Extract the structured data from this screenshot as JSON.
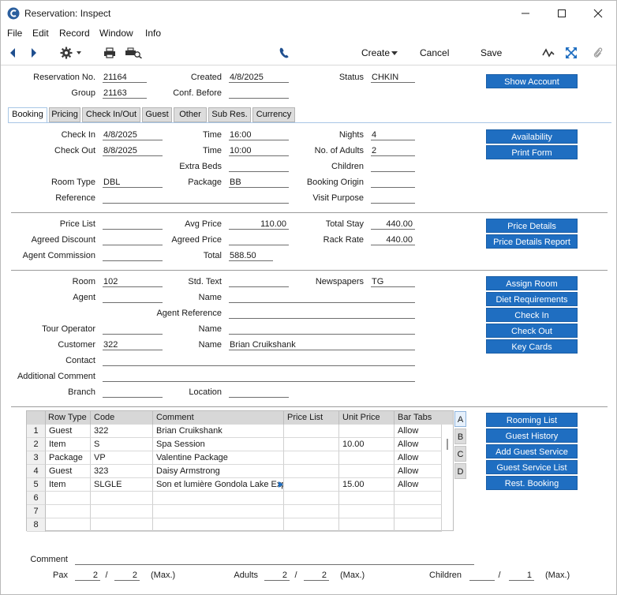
{
  "window": {
    "title": "Reservation: Inspect"
  },
  "menu": [
    "File",
    "Edit",
    "Record",
    "Window",
    "Info"
  ],
  "toolbar": {
    "create": "Create",
    "cancel": "Cancel",
    "save": "Save"
  },
  "header": {
    "reservation_no_label": "Reservation No.",
    "reservation_no": "21164",
    "created_label": "Created",
    "created": "4/8/2025",
    "status_label": "Status",
    "status": "CHKIN",
    "group_label": "Group",
    "group": "21163",
    "conf_before_label": "Conf. Before",
    "conf_before": "",
    "show_account": "Show Account"
  },
  "tabs": [
    "Booking",
    "Pricing",
    "Check In/Out",
    "Guest",
    "Other",
    "Sub Res.",
    "Currency"
  ],
  "booking": {
    "check_in_label": "Check In",
    "check_in": "4/8/2025",
    "time1_label": "Time",
    "time_in": "16:00",
    "nights_label": "Nights",
    "nights": "4",
    "check_out_label": "Check Out",
    "check_out": "8/8/2025",
    "time2_label": "Time",
    "time_out": "10:00",
    "adults_label": "No. of Adults",
    "adults": "2",
    "extra_beds_label": "Extra Beds",
    "extra_beds": "",
    "children_label": "Children",
    "children": "",
    "room_type_label": "Room Type",
    "room_type": "DBL",
    "package_label": "Package",
    "package": "BB",
    "booking_origin_label": "Booking Origin",
    "booking_origin": "",
    "reference_label": "Reference",
    "reference": "",
    "visit_purpose_label": "Visit Purpose",
    "visit_purpose": "",
    "availability": "Availability",
    "print_form": "Print Form"
  },
  "pricing": {
    "price_list_label": "Price List",
    "price_list": "",
    "avg_price_label": "Avg Price",
    "avg_price": "110.00",
    "total_stay_label": "Total Stay",
    "total_stay": "440.00",
    "agreed_discount_label": "Agreed Discount",
    "agreed_discount": "",
    "agreed_price_label": "Agreed Price",
    "agreed_price": "",
    "rack_rate_label": "Rack Rate",
    "rack_rate": "440.00",
    "agent_commission_label": "Agent Commission",
    "agent_commission": "",
    "total_label": "Total",
    "total": "588.50",
    "price_details": "Price Details",
    "price_details_report": "Price Details Report"
  },
  "room": {
    "room_label": "Room",
    "room": "102",
    "std_text_label": "Std. Text",
    "std_text": "",
    "newspapers_label": "Newspapers",
    "newspapers": "TG",
    "agent_label": "Agent",
    "agent": "",
    "name1_label": "Name",
    "agent_name": "",
    "agent_reference_label": "Agent Reference",
    "agent_reference": "",
    "tour_operator_label": "Tour Operator",
    "tour_operator": "",
    "name2_label": "Name",
    "tour_operator_name": "",
    "customer_label": "Customer",
    "customer": "322",
    "name3_label": "Name",
    "customer_name": "Brian Cruikshank",
    "contact_label": "Contact",
    "contact": "",
    "additional_comment_label": "Additional Comment",
    "additional_comment": "",
    "branch_label": "Branch",
    "branch": "",
    "location_label": "Location",
    "location": "",
    "assign_room": "Assign Room",
    "diet_requirements": "Diet Requirements",
    "check_in_btn": "Check In",
    "check_out_btn": "Check Out",
    "key_cards": "Key Cards"
  },
  "grid": {
    "columns": [
      "Row Type",
      "Code",
      "Comment",
      "Price List",
      "Unit Price",
      "Bar Tabs"
    ],
    "rows": [
      {
        "n": "1",
        "type": "Guest",
        "code": "322",
        "comment": "Brian Cruikshank",
        "price_list": "",
        "unit_price": "",
        "bar_tabs": "Allow"
      },
      {
        "n": "2",
        "type": "Item",
        "code": "S",
        "comment": "Spa Session",
        "price_list": "",
        "unit_price": "10.00",
        "bar_tabs": "Allow"
      },
      {
        "n": "3",
        "type": "Package",
        "code": "VP",
        "comment": "Valentine Package",
        "price_list": "",
        "unit_price": "",
        "bar_tabs": "Allow"
      },
      {
        "n": "4",
        "type": "Guest",
        "code": "323",
        "comment": "Daisy Armstrong",
        "price_list": "",
        "unit_price": "",
        "bar_tabs": "Allow"
      },
      {
        "n": "5",
        "type": "Item",
        "code": "SLGLE",
        "comment": "Son et lumière Gondola Lake Exp",
        "price_list": "",
        "unit_price": "15.00",
        "bar_tabs": "Allow"
      },
      {
        "n": "6",
        "type": "",
        "code": "",
        "comment": "",
        "price_list": "",
        "unit_price": "",
        "bar_tabs": ""
      },
      {
        "n": "7",
        "type": "",
        "code": "",
        "comment": "",
        "price_list": "",
        "unit_price": "",
        "bar_tabs": ""
      },
      {
        "n": "8",
        "type": "",
        "code": "",
        "comment": "",
        "price_list": "",
        "unit_price": "",
        "bar_tabs": ""
      }
    ],
    "side_tabs": [
      "A",
      "B",
      "C",
      "D"
    ],
    "buttons": [
      "Rooming List",
      "Guest History",
      "Add Guest Service",
      "Guest Service List",
      "Rest. Booking"
    ]
  },
  "footer": {
    "comment_label": "Comment",
    "comment": "",
    "pax_label": "Pax",
    "pax": "2",
    "pax_max": "2",
    "max1": "(Max.)",
    "adults_label": "Adults",
    "adults": "2",
    "adults_max": "2",
    "max2": "(Max.)",
    "children_label": "Children",
    "children": "",
    "children_max": "1",
    "max3": "(Max.)",
    "slash": "/"
  },
  "colors": {
    "button_blue": "#1f6ec1",
    "tab_active_border": "#a8c6e6"
  }
}
